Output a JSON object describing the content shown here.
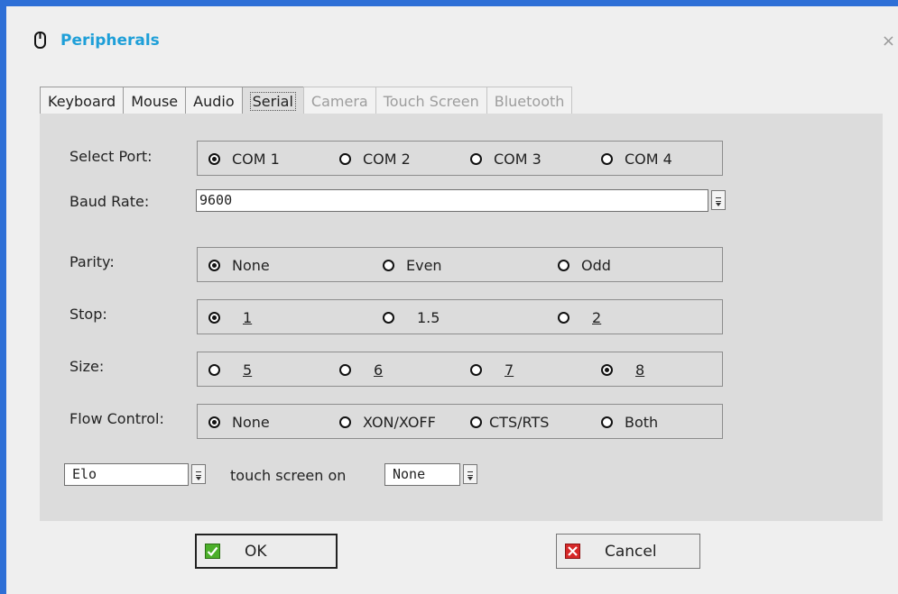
{
  "window": {
    "title": "Peripherals",
    "title_icon": "mouse-icon",
    "close_label": "×"
  },
  "tabs": [
    {
      "label": "Keyboard",
      "state": "normal"
    },
    {
      "label": "Mouse",
      "state": "normal"
    },
    {
      "label": "Audio",
      "state": "normal"
    },
    {
      "label": "Serial",
      "state": "active"
    },
    {
      "label": "Camera",
      "state": "disabled"
    },
    {
      "label": "Touch Screen",
      "state": "disabled"
    },
    {
      "label": "Bluetooth",
      "state": "disabled"
    }
  ],
  "serial": {
    "select_port": {
      "label": "Select Port:",
      "options": [
        "COM 1",
        "COM 2",
        "COM 3",
        "COM 4"
      ],
      "selected": "COM 1"
    },
    "baud_rate": {
      "label": "Baud Rate:",
      "value": "9600"
    },
    "parity": {
      "label": "Parity:",
      "options": [
        "None",
        "Even",
        "Odd"
      ],
      "selected": "None"
    },
    "stop": {
      "label": "Stop:",
      "options": [
        "1",
        "1.5",
        "2"
      ],
      "selected": "1"
    },
    "size": {
      "label": "Size:",
      "options": [
        "5",
        "6",
        "7",
        "8"
      ],
      "selected": "8"
    },
    "flow_control": {
      "label": "Flow Control:",
      "options": [
        "None",
        "XON/XOFF",
        "CTS/RTS",
        "Both"
      ],
      "selected": "None"
    },
    "touch": {
      "device": "Elo",
      "middle_text": "touch screen on",
      "port": "None"
    }
  },
  "buttons": {
    "ok": "OK",
    "cancel": "Cancel"
  },
  "colors": {
    "title_blue": "#1e9fd8",
    "window_edge": "#2e6fd6",
    "ok_green": "#4caf2a",
    "cancel_red": "#d62828"
  }
}
